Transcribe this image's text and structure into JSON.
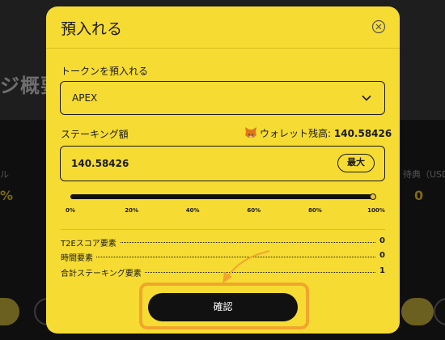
{
  "background": {
    "heading": "ジ概要",
    "left_label": "ル",
    "left_value": "%",
    "right_label": "待典（USDC",
    "right_value": "0"
  },
  "modal": {
    "title": "預入れる",
    "close_icon": "close-icon",
    "token": {
      "label": "トークンを預入れる",
      "selected": "APEX",
      "chevron_icon": "chevron-down-icon"
    },
    "staking": {
      "label": "ステーキング額",
      "wallet_icon": "metamask-fox-icon",
      "wallet_label": "ウォレット残高:",
      "wallet_balance": "140.58426",
      "amount": "140.58426",
      "max_label": "最大"
    },
    "slider": {
      "value_percent": 100,
      "ticks": [
        "0%",
        "20%",
        "40%",
        "60%",
        "80%",
        "100%"
      ]
    },
    "factors": [
      {
        "label": "T2Eスコア要素",
        "value": "0"
      },
      {
        "label": "時間要素",
        "value": "0"
      },
      {
        "label": "合計ステーキング要素",
        "value": "1"
      }
    ],
    "confirm_label": "確認"
  },
  "colors": {
    "modal_bg": "#f6dc32",
    "highlight": "#f0a62d",
    "button_bg": "#111111"
  }
}
